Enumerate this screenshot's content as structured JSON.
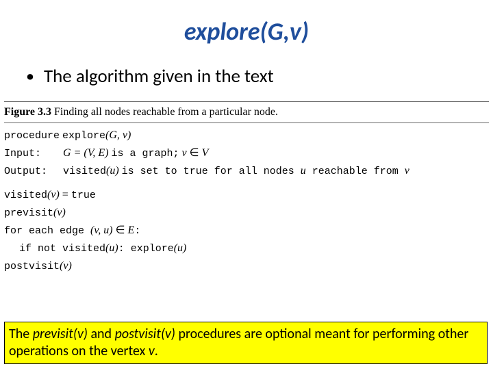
{
  "title": "explore(G,v)",
  "bullet": "The algorithm given in the text",
  "figure": {
    "label": "Figure 3.3",
    "caption": "Finding all nodes reachable from a particular node.",
    "lines": {
      "proc_kw": "procedure",
      "proc_call": "explore",
      "proc_args_open": "(",
      "proc_arg_G": "G",
      "proc_comma": ", ",
      "proc_arg_v": "v",
      "proc_args_close": ")",
      "input_lbl": "Input:",
      "input_eq_lhs": "G",
      "input_eq_mid": " = (",
      "input_eq_V": "V",
      "input_eq_c": ", ",
      "input_eq_E": "E",
      "input_eq_close": ")",
      "input_isagraph": " is a graph;",
      "input_vin": " v",
      "input_in": " ∈ ",
      "input_Vset": "V",
      "output_lbl": "Output:",
      "output_visited": "visited",
      "output_paren_u": "(u)",
      "output_txt1": " is set to true for all nodes ",
      "output_u": "u",
      "output_txt2": " reachable from ",
      "output_v": "v",
      "l1_visited": "visited",
      "l1_paren_v": "(v)",
      "l1_eq": " = ",
      "l1_true": "true",
      "l2_previsit": "previsit",
      "l2_paren_v": "(v)",
      "l3_for": "for each edge ",
      "l3_edge_open": "(",
      "l3_edge_v": "v",
      "l3_edge_c": ", ",
      "l3_edge_u": "u",
      "l3_edge_close": ")",
      "l3_in": " ∈ ",
      "l3_E": "E",
      "l3_colon": ":",
      "l4_if": "if not ",
      "l4_visited": "visited",
      "l4_paren_u": "(u)",
      "l4_colon": ":",
      "l4_explore": "   explore",
      "l4_args": "(u)",
      "l5_postvisit": "postvisit",
      "l5_paren_v": "(v)"
    }
  },
  "note": {
    "t1": "The ",
    "i1": "previsit(v)",
    "t2": " and ",
    "i2": "postvisit(v)",
    "t3": " procedures are optional meant for performing other operations on the vertex ",
    "i3": "v",
    "t4": "."
  }
}
